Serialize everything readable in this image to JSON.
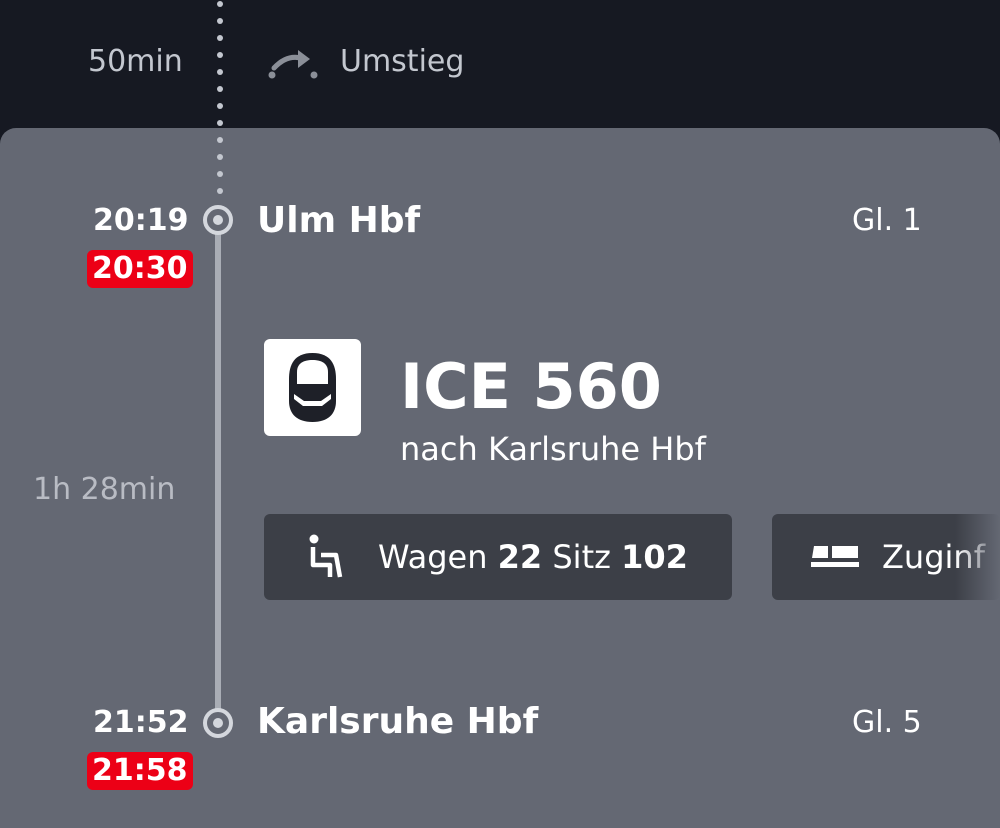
{
  "transfer": {
    "duration": "50min",
    "label": "Umstieg",
    "icon": "transfer-arrow-icon"
  },
  "departure": {
    "time": "20:19",
    "delayed_time": "20:30",
    "station": "Ulm Hbf",
    "platform": "Gl. 1"
  },
  "segment": {
    "duration": "1h 28min"
  },
  "train": {
    "icon": "ice-train-icon",
    "name": "ICE 560",
    "destination": "nach Karlsruhe Hbf",
    "seat_chip": {
      "icon": "seat-icon",
      "wagon_label": "Wagen",
      "wagon": "22",
      "seat_label": "Sitz",
      "seat": "102"
    },
    "info_chip": {
      "icon": "train-info-icon",
      "label": "Zuginf"
    }
  },
  "arrival": {
    "time": "21:52",
    "delayed_time": "21:58",
    "station": "Karlsruhe Hbf",
    "platform": "Gl. 5"
  },
  "colors": {
    "delay_badge": "#ec0016",
    "card": "#646873",
    "chip": "#3c3f47",
    "header": "#161922"
  }
}
